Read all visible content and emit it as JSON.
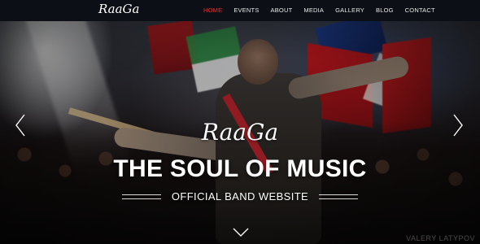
{
  "brand": {
    "logo_text": "RaaGa"
  },
  "nav": {
    "items": [
      {
        "label": "HOME",
        "active": true
      },
      {
        "label": "EVENTS"
      },
      {
        "label": "ABOUT"
      },
      {
        "label": "MEDIA"
      },
      {
        "label": "GALLERY"
      },
      {
        "label": "BLOG"
      },
      {
        "label": "CONTACT"
      }
    ]
  },
  "hero": {
    "brand_script": "RaaGa",
    "title": "THE SOUL OF MUSIC",
    "subtitle": "OFFICIAL BAND WEBSITE",
    "watermark": "VALERY LATYPOV"
  },
  "icons": {
    "prev": "chevron-left-icon",
    "next": "chevron-right-icon",
    "scroll": "chevron-down-icon"
  },
  "colors": {
    "nav_bg": "#0c0f16",
    "nav_active": "#e2352f",
    "text": "#ffffff"
  }
}
